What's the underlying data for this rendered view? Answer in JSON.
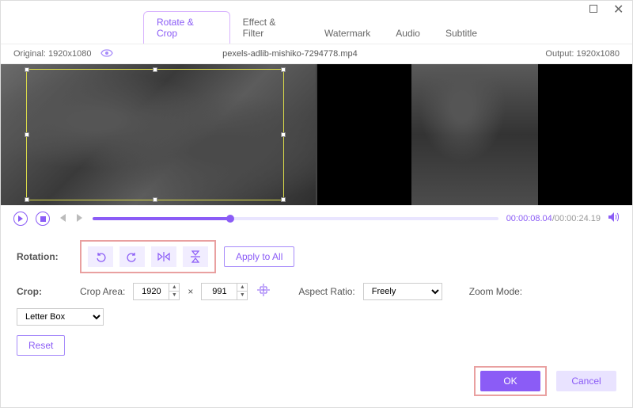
{
  "window": {
    "maximize_icon": "maximize",
    "close_icon": "close"
  },
  "tabs": [
    {
      "label": "Rotate & Crop",
      "active": true
    },
    {
      "label": "Effect & Filter",
      "active": false
    },
    {
      "label": "Watermark",
      "active": false
    },
    {
      "label": "Audio",
      "active": false
    },
    {
      "label": "Subtitle",
      "active": false
    }
  ],
  "info": {
    "original_label": "Original:",
    "original_res": "1920x1080",
    "filename": "pexels-adlib-mishiko-7294778.mp4",
    "output_label": "Output:",
    "output_res": "1920x1080"
  },
  "transport": {
    "current_time": "00:00:08.04",
    "duration": "00:00:24.19",
    "progress_pct": 34
  },
  "rotation": {
    "label": "Rotation:",
    "buttons": [
      "rotate-left",
      "rotate-right",
      "flip-horizontal",
      "flip-vertical"
    ],
    "apply_all": "Apply to All"
  },
  "crop": {
    "label": "Crop:",
    "area_label": "Crop Area:",
    "width": "1920",
    "height": "991",
    "sep": "×",
    "aspect_label": "Aspect Ratio:",
    "aspect_value": "Freely",
    "zoom_label": "Zoom Mode:",
    "zoom_value": "Letter Box",
    "reset": "Reset"
  },
  "footer": {
    "ok": "OK",
    "cancel": "Cancel"
  }
}
